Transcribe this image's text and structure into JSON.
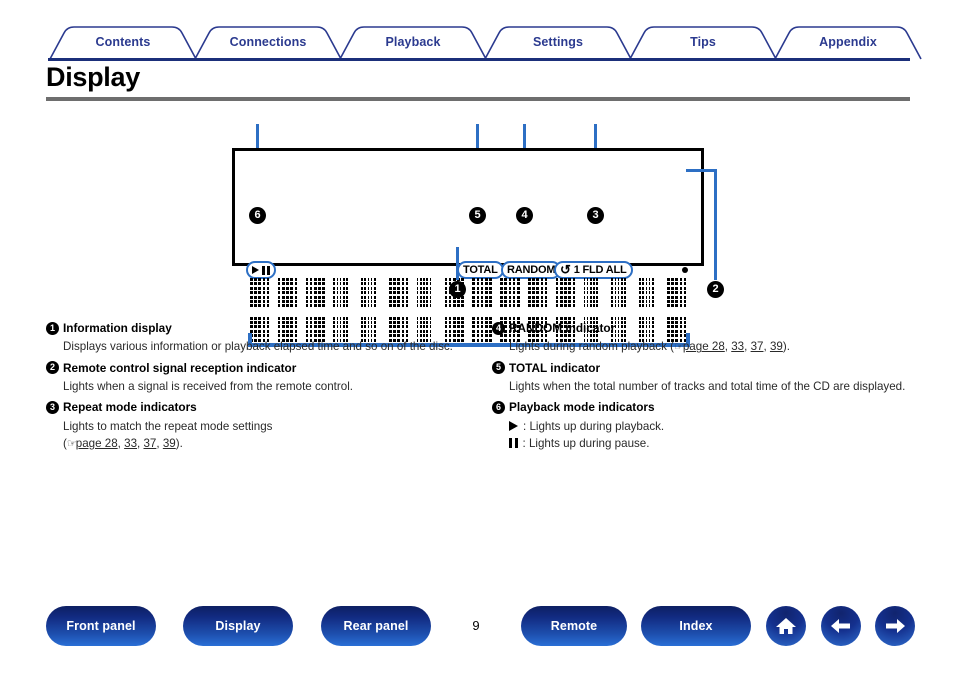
{
  "tabs": [
    {
      "label": "Contents"
    },
    {
      "label": "Connections"
    },
    {
      "label": "Playback"
    },
    {
      "label": "Settings"
    },
    {
      "label": "Tips"
    },
    {
      "label": "Appendix"
    }
  ],
  "page": {
    "title": "Display",
    "number": "9"
  },
  "diagram": {
    "callouts": [
      {
        "id": "1",
        "label": "1"
      },
      {
        "id": "2",
        "label": "2"
      },
      {
        "id": "3",
        "label": "3"
      },
      {
        "id": "4",
        "label": "4"
      },
      {
        "id": "5",
        "label": "5"
      },
      {
        "id": "6",
        "label": "6"
      }
    ],
    "indicators": {
      "total": "TOTAL",
      "random": "RANDOM",
      "repeat_symbol": "↺",
      "repeat_text": "1 FLD ALL"
    },
    "playback_badge": {
      "play_icon": "play-triangle",
      "pause_icon": "pause-bars"
    },
    "sensor_icon": "remote-sensor-dot"
  },
  "entries_left": [
    {
      "num": "1",
      "title": "Information display",
      "body": "Displays various information or playback elapsed time and so on of the disc."
    },
    {
      "num": "2",
      "title": "Remote control signal reception indicator",
      "body": "Lights when a signal is received from the remote control."
    },
    {
      "num": "3",
      "title": "Repeat mode indicators",
      "body_line1": "Lights to match the repeat mode settings",
      "ref_open": "(",
      "ref_hand": "☞",
      "ref_pages": [
        "page 28",
        "33",
        "37",
        "39"
      ],
      "ref_close": ")."
    }
  ],
  "entries_right": [
    {
      "num": "4",
      "title": "RANDOM indicator",
      "body_prefix": "Lights during random playback (",
      "ref_hand": "☞",
      "ref_pages": [
        "page 28",
        "33",
        "37",
        "39"
      ],
      "body_suffix": ")."
    },
    {
      "num": "5",
      "title": "TOTAL indicator",
      "body": "Lights when the total number of tracks and total time of the CD are displayed."
    },
    {
      "num": "6",
      "title": "Playback mode indicators",
      "line_play": ": Lights up during playback.",
      "line_pause": ": Lights up during pause."
    }
  ],
  "bottomnav": {
    "buttons": [
      {
        "label": "Front panel"
      },
      {
        "label": "Display"
      },
      {
        "label": "Rear panel"
      },
      {
        "label": "Remote"
      },
      {
        "label": "Index"
      }
    ],
    "icons": [
      {
        "name": "home-icon"
      },
      {
        "name": "arrow-left-icon"
      },
      {
        "name": "arrow-right-icon"
      }
    ]
  },
  "colors": {
    "tab_text": "#2b3a8f",
    "tab_rule": "#1b2f7a",
    "accent_blue": "#2d6fc4",
    "title_rule": "#6e6e6e"
  }
}
